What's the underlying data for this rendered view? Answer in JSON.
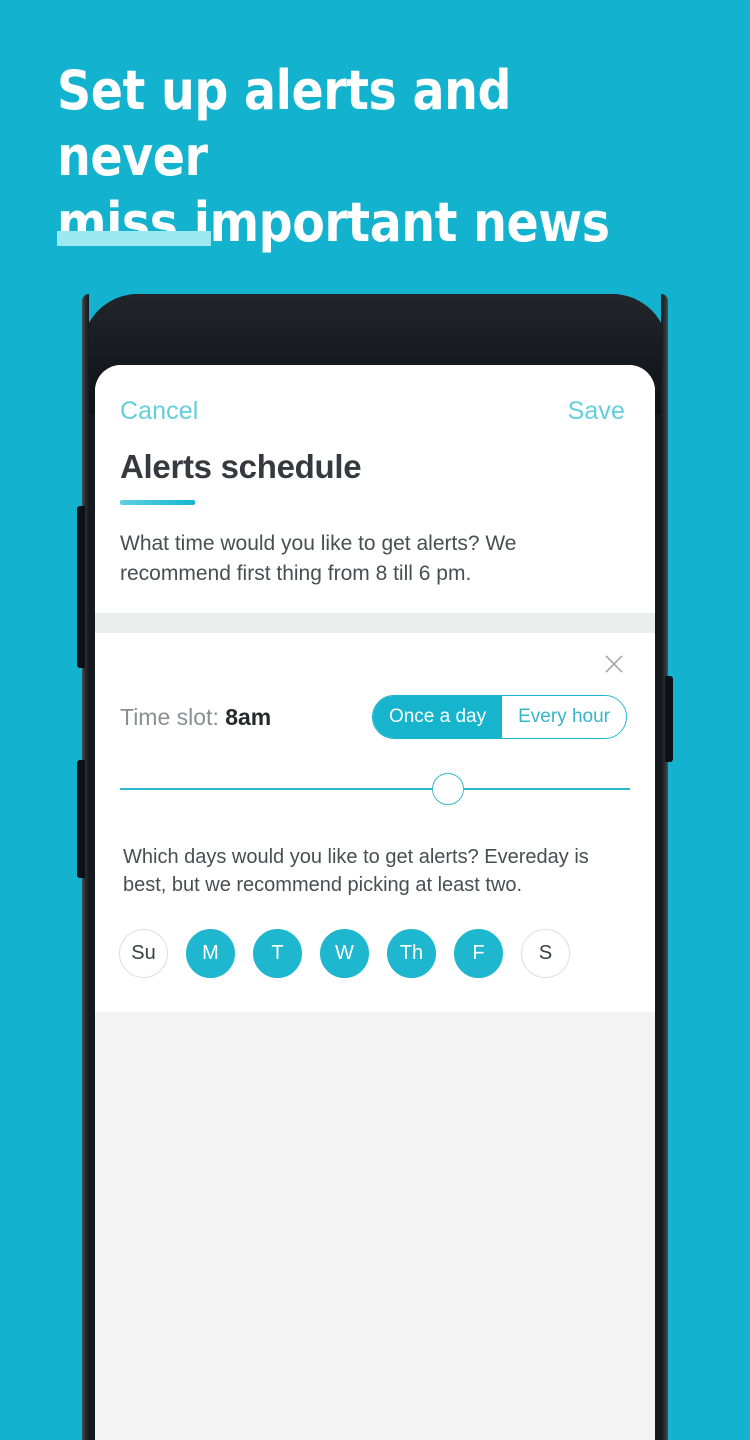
{
  "theme": {
    "brand_cyan": "#13b2ce",
    "accent_cyan": "#17b5cd",
    "promo_rule": "#9de9f2",
    "text_dark": "#36393e",
    "text_muted": "#8b8e93",
    "screen_gray": "#f3f3f4",
    "device_black": "#15181c"
  },
  "promo": {
    "headline": "Set up alerts and never\nmiss important news"
  },
  "app": {
    "nav": {
      "cancel_label": "Cancel",
      "save_label": "Save"
    },
    "sheet": {
      "title_strong": "Alerts",
      "title_rest": " schedule",
      "description": "What time would you like to get alerts? We recommend first thing from 8 till 6 pm."
    },
    "slot": {
      "close_icon": "close-icon",
      "label_prefix": "Time slot: ",
      "value": "8am",
      "segments": [
        {
          "label": "Once a day",
          "selected": true
        },
        {
          "label": "Every hour",
          "selected": false
        }
      ],
      "slider": {
        "value_label": "8am",
        "thumb_position_pct": 62
      }
    },
    "days": {
      "description": "Which days would you like to get alerts? Evereday is best, but we recommend picking at least two.",
      "items": [
        {
          "label": "Su",
          "selected": false
        },
        {
          "label": "M",
          "selected": true
        },
        {
          "label": "T",
          "selected": true
        },
        {
          "label": "W",
          "selected": true
        },
        {
          "label": "Th",
          "selected": true
        },
        {
          "label": "F",
          "selected": true
        },
        {
          "label": "S",
          "selected": false
        }
      ]
    }
  }
}
